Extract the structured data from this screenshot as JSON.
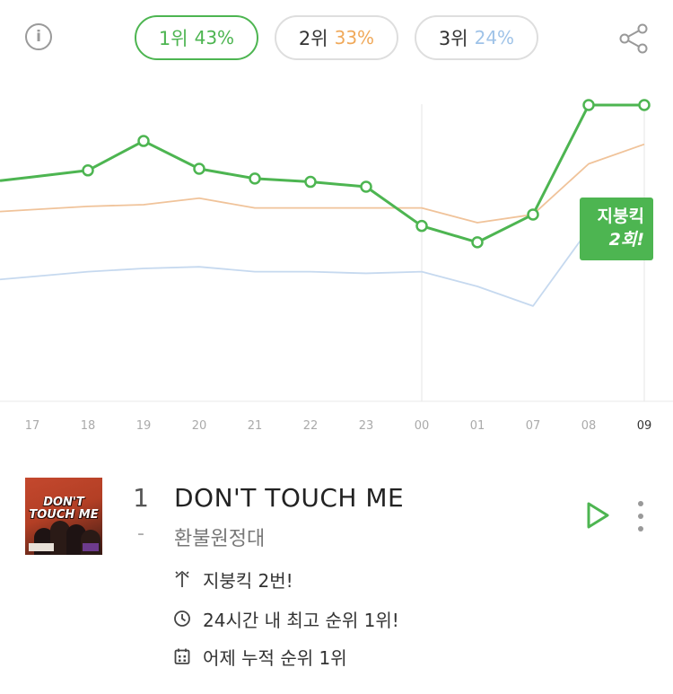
{
  "header": {
    "info_icon": "info-circle-icon",
    "share_icon": "share-icon",
    "pills": [
      {
        "label": "1위",
        "pct": "43%",
        "color": "#4db551"
      },
      {
        "label": "2위",
        "pct": "33%",
        "color": "#f0a95a"
      },
      {
        "label": "3위",
        "pct": "24%",
        "color": "#9fc3e8"
      }
    ]
  },
  "chart_data": {
    "type": "line",
    "categories": [
      "17",
      "18",
      "19",
      "20",
      "21",
      "22",
      "23",
      "00",
      "01",
      "07",
      "08",
      "09"
    ],
    "current_category": "09",
    "series": [
      {
        "color": "#4db551",
        "values": [
          55,
          59,
          77,
          60,
          54,
          52,
          49,
          25,
          15,
          32,
          99,
          99
        ]
      },
      {
        "color": "#f0c39a",
        "values": [
          35,
          37,
          38,
          42,
          36,
          36,
          36,
          36,
          27,
          32,
          63,
          75
        ]
      },
      {
        "color": "#c6d9ef",
        "values": [
          -6,
          -3,
          -1,
          0,
          -3,
          -3,
          -4,
          -3,
          -12,
          -24,
          23,
          30
        ]
      }
    ],
    "annotation": {
      "line1": "지붕킥",
      "line2": "2회!"
    }
  },
  "song": {
    "rank": "1",
    "rank_change": "-",
    "title": "DON'T TOUCH ME",
    "artist": "환불원정대",
    "cover_text_1": "DON'T",
    "cover_text_2": "TOUCH ME",
    "facts": [
      {
        "icon": "roof-kick-icon",
        "text": "지붕킥 2번!"
      },
      {
        "icon": "clock-icon",
        "text": "24시간 내 최고 순위 1위!"
      },
      {
        "icon": "calendar-icon",
        "text": "어제 누적 순위 1위"
      }
    ]
  }
}
